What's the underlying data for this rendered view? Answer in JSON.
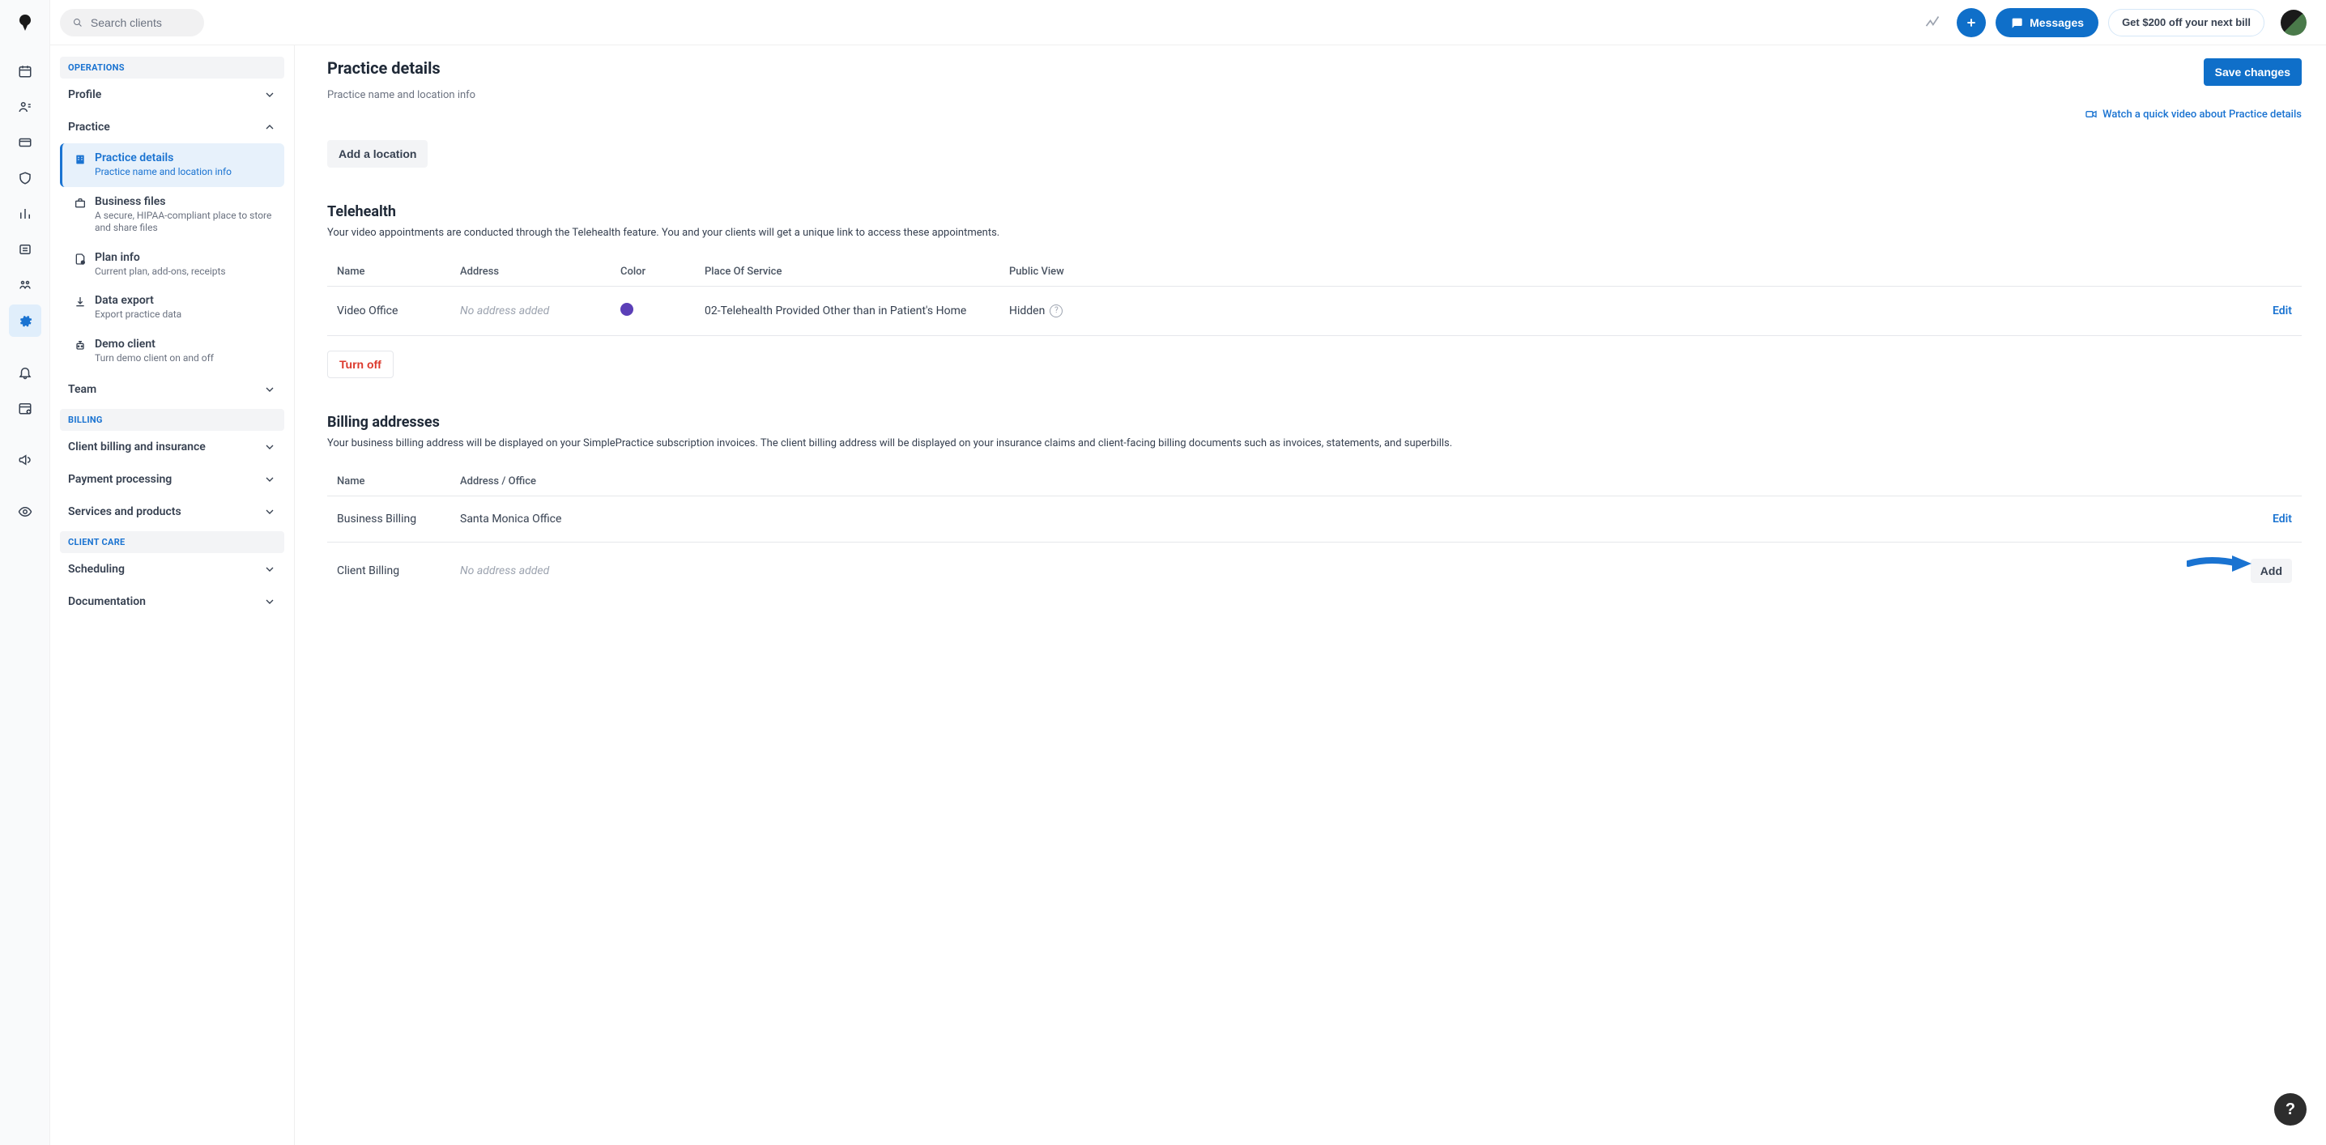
{
  "header": {
    "search_placeholder": "Search clients",
    "messages_label": "Messages",
    "promo_label": "Get $200 off your next bill"
  },
  "sidebar": {
    "sections": {
      "operations": "OPERATIONS",
      "billing": "BILLING",
      "client_care": "CLIENT CARE"
    },
    "groups": {
      "profile": "Profile",
      "practice": "Practice",
      "team": "Team",
      "client_billing": "Client billing and insurance",
      "payment_processing": "Payment processing",
      "services_products": "Services and products",
      "scheduling": "Scheduling",
      "documentation": "Documentation"
    },
    "practice_items": [
      {
        "title": "Practice details",
        "desc": "Practice name and location info"
      },
      {
        "title": "Business files",
        "desc": "A secure, HIPAA-compliant place to store and share files"
      },
      {
        "title": "Plan info",
        "desc": "Current plan, add-ons, receipts"
      },
      {
        "title": "Data export",
        "desc": "Export practice data"
      },
      {
        "title": "Demo client",
        "desc": "Turn demo client on and off"
      }
    ]
  },
  "page": {
    "title": "Practice details",
    "subtitle": "Practice name and location info",
    "save_label": "Save changes",
    "video_link": "Watch a quick video about Practice details",
    "add_location_label": "Add a location"
  },
  "telehealth": {
    "title": "Telehealth",
    "desc": "Your video appointments are conducted through the Telehealth feature. You and your clients will get a unique link to access these appointments.",
    "cols": {
      "name": "Name",
      "address": "Address",
      "color": "Color",
      "pos": "Place Of Service",
      "view": "Public View"
    },
    "row": {
      "name": "Video Office",
      "address": "No address added",
      "color": "#5b3fb7",
      "pos": "02-Telehealth Provided Other than in Patient's Home",
      "view": "Hidden",
      "action": "Edit"
    },
    "turn_off": "Turn off"
  },
  "billing": {
    "title": "Billing addresses",
    "desc": "Your business billing address will be displayed on your SimplePractice subscription invoices. The client billing address will be displayed on your insurance claims and client-facing billing documents such as invoices, statements, and superbills.",
    "cols": {
      "name": "Name",
      "address": "Address / Office"
    },
    "rows": [
      {
        "name": "Business Billing",
        "address": "Santa Monica Office",
        "action": "Edit",
        "italic": false
      },
      {
        "name": "Client Billing",
        "address": "No address added",
        "action": "Add",
        "italic": true
      }
    ]
  }
}
